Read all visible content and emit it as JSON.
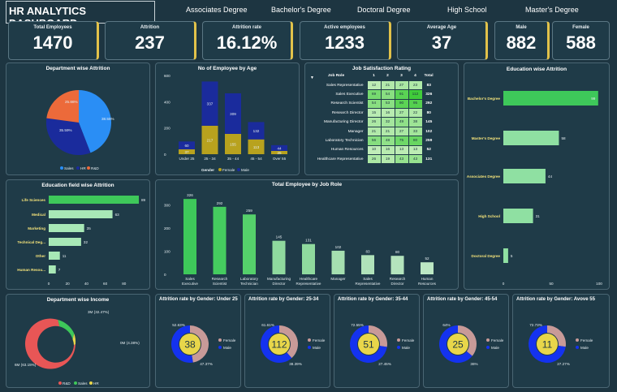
{
  "title": "HR ANALYTICS DASHBOARD",
  "tabs": [
    "Associates Degree",
    "Bachelor's Degree",
    "Doctoral Degree",
    "High School",
    "Master's Degree"
  ],
  "kpis": {
    "total_employees": {
      "label": "Total Employees",
      "value": "1470"
    },
    "attrition": {
      "label": "Attrition",
      "value": "237"
    },
    "attrition_rate": {
      "label": "Attrition rate",
      "value": "16.12%"
    },
    "active_employees": {
      "label": "Active employees",
      "value": "1233"
    },
    "average_age": {
      "label": "Average Age",
      "value": "37"
    },
    "male": {
      "label": "Male",
      "value": "882"
    },
    "female": {
      "label": "Female",
      "value": "588"
    }
  },
  "panels": {
    "dept_attrition": "Department wise Attrition",
    "age": "No of Employee by Age",
    "job_satisfaction": "Job Satisfaction Rating",
    "education_attrition": "Education wise Attrition",
    "edu_field": "Education field wise Attrition",
    "job_role": "Total Employee by Job Role",
    "dept_income": "Department wise Income",
    "g_under25": "Attrition rate by Gender: Under 25",
    "g_25_34": "Attrition rate by Gender: 25-34",
    "g_35_44": "Attrition rate by Gender: 35-44",
    "g_45_54": "Attrition rate by Gender: 45-54",
    "g_over55": "Attrition rate by Gender: Avove 55"
  },
  "legends": {
    "sales": "Sales",
    "hr": "HR",
    "rd": "R&D",
    "gender": "Gender",
    "female": "Female",
    "male": "Male"
  },
  "colors": {
    "sales": "#2a8ef5",
    "hr": "#1a2b9c",
    "rd": "#ec6a3a",
    "female_bar": "#b8a21e",
    "male_bar": "#1a2b9c",
    "income_rd": "#e85656",
    "income_sales": "#3ec85a",
    "income_hr": "#e8d64a",
    "donut_female": "#c89a98",
    "donut_male": "#1432ef"
  },
  "job_satisfaction": {
    "header_role": "Job Role",
    "columns": [
      "1",
      "2",
      "3",
      "4"
    ],
    "total_label": "Total",
    "rows": [
      {
        "role": "Sales Representative",
        "v": [
          12,
          21,
          27,
          23
        ],
        "total": "83"
      },
      {
        "role": "Sales Executive",
        "v": [
          69,
          54,
          91,
          112
        ],
        "total": "326"
      },
      {
        "role": "Research Scientist",
        "v": [
          54,
          53,
          90,
          95
        ],
        "total": "292"
      },
      {
        "role": "Research Director",
        "v": [
          15,
          16,
          27,
          22
        ],
        "total": "80"
      },
      {
        "role": "Manufacturing Director",
        "v": [
          26,
          32,
          49,
          38
        ],
        "total": "145"
      },
      {
        "role": "Manager",
        "v": [
          21,
          21,
          27,
          33
        ],
        "total": "102"
      },
      {
        "role": "Laboratory Technician",
        "v": [
          56,
          48,
          75,
          80
        ],
        "total": "259"
      },
      {
        "role": "Human Resources",
        "v": [
          10,
          16,
          13,
          13
        ],
        "total": "52"
      },
      {
        "role": "Healthcare Representative",
        "v": [
          26,
          19,
          43,
          43
        ],
        "total": "131"
      }
    ]
  },
  "chart_data": [
    {
      "type": "pie",
      "title": "Department wise Attrition",
      "categories": [
        "Sales",
        "HR",
        "R&D"
      ],
      "values": [
        38.55,
        35.59,
        25.86
      ],
      "labels": [
        "38.55%",
        "35.59%",
        "25.86%"
      ]
    },
    {
      "type": "bar",
      "title": "No of Employee by Age",
      "categories": [
        "Under 25",
        "25 - 34",
        "35 - 44",
        "45 - 54",
        "Over 55"
      ],
      "series": [
        {
          "name": "Female",
          "values": [
            37,
            217,
            155,
            113,
            25
          ]
        },
        {
          "name": "Male",
          "values": [
            60,
            337,
            309,
            132,
            44
          ]
        }
      ],
      "ylim": [
        0,
        600
      ],
      "yticks": [
        "0",
        "200",
        "400",
        "600"
      ]
    },
    {
      "type": "bar",
      "title": "Education wise Attrition",
      "categories": [
        "Bachelor's Degree",
        "Master's Degree",
        "Associates Degree",
        "High School",
        "Doctoral Degree"
      ],
      "values": [
        99,
        58,
        44,
        31,
        5
      ],
      "xlim": [
        0,
        100
      ],
      "xticks": [
        "0",
        "50",
        "100"
      ]
    },
    {
      "type": "bar",
      "title": "Education field wise Attrition",
      "categories": [
        "Life Sciences",
        "Medical",
        "Marketing",
        "Technical Deg...",
        "Other",
        "Human Resou..."
      ],
      "values": [
        89,
        63,
        35,
        32,
        11,
        7
      ],
      "xlim": [
        0,
        89
      ],
      "xticks": [
        "0",
        "20",
        "40",
        "60",
        "80"
      ]
    },
    {
      "type": "bar",
      "title": "Total Employee by Job Role",
      "categories": [
        "Sales Executive",
        "Research Scientist",
        "Laboratory Technician",
        "Manufacturing Director",
        "Healthcare Representative",
        "Manager",
        "Sales Representative",
        "Research Director",
        "Human Resources"
      ],
      "values": [
        326,
        292,
        259,
        145,
        131,
        102,
        83,
        80,
        52
      ],
      "ylim": [
        0,
        326
      ],
      "yticks": [
        "0",
        "100",
        "200",
        "300"
      ]
    },
    {
      "type": "pie",
      "title": "Department wise Income",
      "categories": [
        "R&D",
        "Sales",
        "HR"
      ],
      "values": [
        63.15,
        32.47,
        4.38
      ],
      "labels": [
        "6M (63.15%)",
        "3M (32.47%)",
        "0M (4.38%)"
      ]
    },
    {
      "type": "pie",
      "title": "Attrition rate by Gender: Under 25",
      "categories": [
        "Female",
        "Male"
      ],
      "values": [
        47.37,
        52.63
      ],
      "labels": [
        "47.37%",
        "52.63%"
      ],
      "center": "38"
    },
    {
      "type": "pie",
      "title": "Attrition rate by Gender: 25-34",
      "categories": [
        "Female",
        "Male"
      ],
      "values": [
        38.39,
        61.61
      ],
      "labels": [
        "38.39%",
        "61.61%"
      ],
      "center": "112"
    },
    {
      "type": "pie",
      "title": "Attrition rate by Gender: 35-44",
      "categories": [
        "Female",
        "Male"
      ],
      "values": [
        27.45,
        72.55
      ],
      "labels": [
        "27.45%",
        "72.55%"
      ],
      "center": "51"
    },
    {
      "type": "pie",
      "title": "Attrition rate by Gender: 45-54",
      "categories": [
        "Female",
        "Male"
      ],
      "values": [
        36,
        64
      ],
      "labels": [
        "36%",
        "64%"
      ],
      "center": "25"
    },
    {
      "type": "pie",
      "title": "Attrition rate by Gender: Avove 55",
      "categories": [
        "Female",
        "Male"
      ],
      "values": [
        27.27,
        72.73
      ],
      "labels": [
        "27.27%",
        "72.73%"
      ],
      "center": "11"
    }
  ]
}
